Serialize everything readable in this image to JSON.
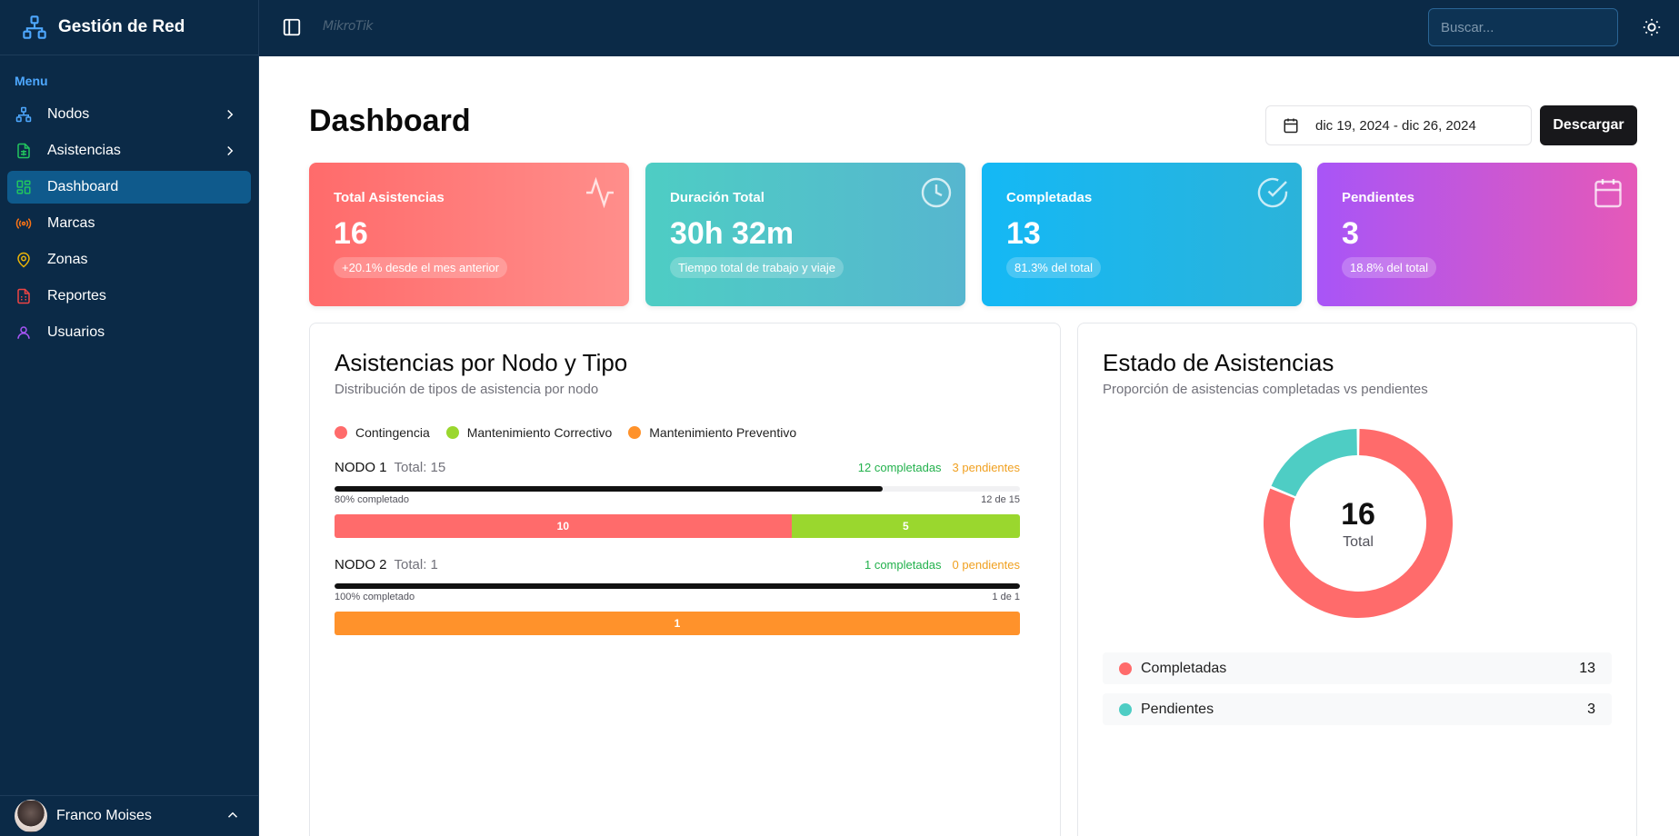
{
  "app": {
    "title": "Gestión de Red"
  },
  "sidebar": {
    "menu_label": "Menu",
    "items": [
      {
        "label": "Nodos",
        "icon": "network-icon",
        "color": "#4ea8ff",
        "has_chevron": true
      },
      {
        "label": "Asistencias",
        "icon": "file-sheet-icon",
        "color": "#22c55e",
        "has_chevron": true
      },
      {
        "label": "Dashboard",
        "icon": "layout-grid-icon",
        "color": "#22c55e",
        "active": true
      },
      {
        "label": "Marcas",
        "icon": "radio-icon",
        "color": "#f97316"
      },
      {
        "label": "Zonas",
        "icon": "map-pin-icon",
        "color": "#eab308"
      },
      {
        "label": "Reportes",
        "icon": "file-report-icon",
        "color": "#ef4444"
      },
      {
        "label": "Usuarios",
        "icon": "user-icon",
        "color": "#a855f7"
      }
    ],
    "user": {
      "name": "Franco Moises"
    }
  },
  "topbar": {
    "logo": "MikroTik",
    "search_placeholder": "Buscar..."
  },
  "main": {
    "title": "Dashboard",
    "date_range": "dic 19, 2024 - dic 26, 2024",
    "download_label": "Descargar"
  },
  "stats": [
    {
      "title": "Total Asistencias",
      "value": "16",
      "note": "+20.1% desde el mes anterior",
      "icon": "activity-icon"
    },
    {
      "title": "Duración Total",
      "value": "30h 32m",
      "note": "Tiempo total de trabajo y viaje",
      "icon": "clock-icon"
    },
    {
      "title": "Completadas",
      "value": "13",
      "note": "81.3% del total",
      "icon": "check-circle-icon"
    },
    {
      "title": "Pendientes",
      "value": "3",
      "note": "18.8% del total",
      "icon": "calendar-icon"
    }
  ],
  "nodes_card": {
    "title": "Asistencias por Nodo y Tipo",
    "subtitle": "Distribución de tipos de asistencia por nodo",
    "legend": [
      {
        "label": "Contingencia",
        "color": "#ff6b6b"
      },
      {
        "label": "Mantenimiento Correctivo",
        "color": "#9ad72e"
      },
      {
        "label": "Mantenimiento Preventivo",
        "color": "#ff922b"
      }
    ],
    "nodes": [
      {
        "name": "NODO 1",
        "total": "Total: 15",
        "completed": "12 completadas",
        "pending": "3 pendientes",
        "progress": 0.8,
        "progress_label": "80% completado",
        "ratio": "12 de 15",
        "segments": [
          {
            "label": "10",
            "value": 10,
            "color": "#ff6b6b"
          },
          {
            "label": "5",
            "value": 5,
            "color": "#9ad72e"
          }
        ]
      },
      {
        "name": "NODO 2",
        "total": "Total: 1",
        "completed": "1 completadas",
        "pending": "0 pendientes",
        "progress": 1.0,
        "progress_label": "100% completado",
        "ratio": "1 de 1",
        "segments": [
          {
            "label": "1",
            "value": 1,
            "color": "#ff922b"
          }
        ]
      }
    ]
  },
  "status_card": {
    "title": "Estado de Asistencias",
    "subtitle": "Proporción de asistencias completadas vs pendientes",
    "center_value": "16",
    "center_label": "Total",
    "items": [
      {
        "label": "Completadas",
        "value": "13",
        "color": "#ff6b6b"
      },
      {
        "label": "Pendientes",
        "value": "3",
        "color": "#4ecdc4"
      }
    ]
  },
  "chart_data": {
    "type": "pie",
    "categories": [
      "Completadas",
      "Pendientes"
    ],
    "values": [
      13,
      3
    ],
    "colors": [
      "#ff6b6b",
      "#4ecdc4"
    ]
  }
}
